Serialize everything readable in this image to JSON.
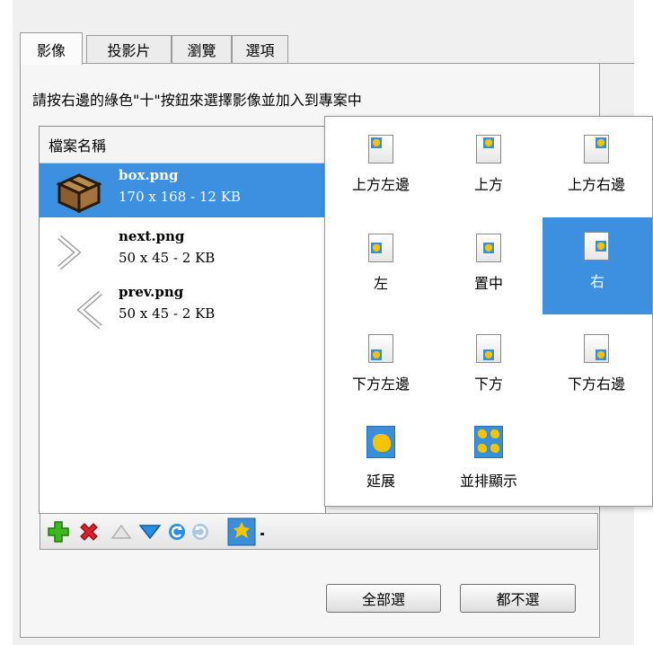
{
  "tabs": [
    {
      "label": "影像",
      "active": true
    },
    {
      "label": "投影片",
      "active": false
    },
    {
      "label": "瀏覽",
      "active": false
    },
    {
      "label": "選項",
      "active": false
    }
  ],
  "instruction": "請按右邊的綠色\"十\"按鈕來選擇影像並加入到專案中",
  "file_list": {
    "header": "檔案名稱",
    "items": [
      {
        "name": "box.png",
        "meta": "170 x 168 - 12 KB",
        "icon": "box-icon",
        "selected": true
      },
      {
        "name": "next.png",
        "meta": "50 x 45 - 2 KB",
        "icon": "chevron-right-icon",
        "selected": false
      },
      {
        "name": "prev.png",
        "meta": "50 x 45 - 2 KB",
        "icon": "chevron-left-icon",
        "selected": false
      }
    ]
  },
  "toolbar": {
    "icons": [
      "add-icon",
      "remove-icon",
      "move-up-icon",
      "move-down-icon",
      "rotate-left-icon",
      "rotate-right-icon",
      "image-position-icon",
      "dropdown-arrow-icon"
    ]
  },
  "position_menu": {
    "options": [
      {
        "label": "上方左邊",
        "key": "top-left"
      },
      {
        "label": "上方",
        "key": "top"
      },
      {
        "label": "上方右邊",
        "key": "top-right"
      },
      {
        "label": "左",
        "key": "left"
      },
      {
        "label": "置中",
        "key": "center"
      },
      {
        "label": "右",
        "key": "right",
        "selected": true
      },
      {
        "label": "下方左邊",
        "key": "bottom-left"
      },
      {
        "label": "下方",
        "key": "bottom"
      },
      {
        "label": "下方右邊",
        "key": "bottom-right"
      },
      {
        "label": "延展",
        "key": "stretch"
      },
      {
        "label": "並排顯示",
        "key": "tile"
      }
    ]
  },
  "buttons": {
    "select_all": "全部選",
    "select_none": "都不選"
  },
  "colors": {
    "selection": "#3d8fe0",
    "add_green": "#3cb81e",
    "remove_red": "#d8202a",
    "down_blue": "#2a8fe0"
  }
}
